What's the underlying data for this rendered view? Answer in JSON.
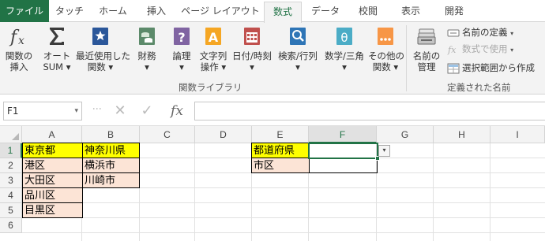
{
  "tabs": [
    {
      "label": "ファイル",
      "state": "file"
    },
    {
      "label": "タッチ",
      "state": "normal"
    },
    {
      "label": "ホーム",
      "state": "normal"
    },
    {
      "label": "挿入",
      "state": "normal"
    },
    {
      "label": "ページ レイアウト",
      "state": "normal"
    },
    {
      "label": "数式",
      "state": "active"
    },
    {
      "label": "データ",
      "state": "normal"
    },
    {
      "label": "校閲",
      "state": "normal"
    },
    {
      "label": "表示",
      "state": "normal"
    },
    {
      "label": "開発",
      "state": "normal"
    }
  ],
  "ribbon": {
    "buttons": [
      {
        "label": "関数の\n挿入",
        "icon": "insert-function-icon"
      },
      {
        "label": "オート\nSUM ▾",
        "icon": "autosum-icon"
      },
      {
        "label": "最近使用した\n関数 ▾",
        "icon": "recently-used-icon"
      },
      {
        "label": "財務\n▾",
        "icon": "financial-icon"
      },
      {
        "label": "論理\n▾",
        "icon": "logical-icon"
      },
      {
        "label": "文字列\n操作 ▾",
        "icon": "text-icon"
      },
      {
        "label": "日付/時刻\n▾",
        "icon": "date-time-icon"
      },
      {
        "label": "検索/行列\n▾",
        "icon": "lookup-icon"
      },
      {
        "label": "数学/三角\n▾",
        "icon": "math-trig-icon"
      },
      {
        "label": "その他の\n関数 ▾",
        "icon": "more-functions-icon"
      },
      {
        "label": "名前の\n管理",
        "icon": "name-manager-icon"
      }
    ],
    "group_function_library": "関数ライブラリ",
    "group_defined_names": "定義された名前",
    "defined_names": {
      "define_name": "名前の定義",
      "define_name_caret": "▾",
      "use_in_formula": "数式で使用",
      "use_in_formula_caret": "▾",
      "create_from_selection": "選択範囲から作成"
    }
  },
  "formula_bar": {
    "name_box": "F1",
    "name_box_arrow": "▾",
    "cancel": "✕",
    "enter": "✓",
    "fx": "fx",
    "formula_value": ""
  },
  "sheet": {
    "columns": [
      "A",
      "B",
      "C",
      "D",
      "E",
      "F",
      "G",
      "H",
      "I"
    ],
    "rows": [
      "1",
      "2",
      "3",
      "4",
      "5",
      "6"
    ],
    "selected_cell": "F1",
    "dropdown_arrow": "▾",
    "cells": {
      "A1": "東京都",
      "A2": "港区",
      "A3": "大田区",
      "A4": "品川区",
      "A5": "目黒区",
      "B1": "神奈川県",
      "B2": "横浜市",
      "B3": "川崎市",
      "E1": "都道府県",
      "E2": "市区",
      "F1": "",
      "F2": ""
    }
  },
  "colors": {
    "accent": "#217346",
    "header_yellow": "#ffff00",
    "value_peach": "#fce4d6"
  }
}
